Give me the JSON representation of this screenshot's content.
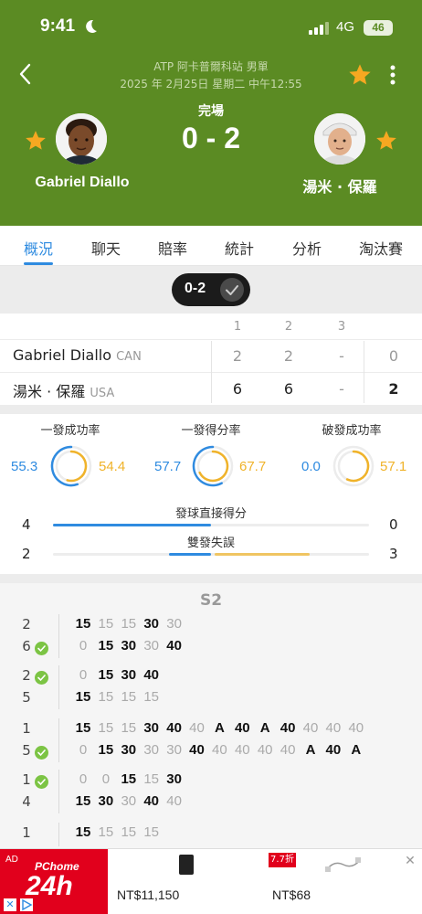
{
  "status_bar": {
    "time": "9:41",
    "network": "4G",
    "battery": "46"
  },
  "header": {
    "event_title": "ATP 阿卡普爾科站 男單",
    "event_date": "2025 年 2月25日 星期二 中午12:55",
    "match_status": "完場",
    "score": "0 - 2",
    "player_left": "Gabriel Diallo",
    "player_right": "湯米 · 保羅"
  },
  "tabs": [
    "概況",
    "聊天",
    "賠率",
    "統計",
    "分析",
    "淘汰賽"
  ],
  "set_pill": {
    "label": "0-2"
  },
  "score_table": {
    "set_headers": [
      "1",
      "2",
      "3"
    ],
    "rows": [
      {
        "name": "Gabriel Diallo",
        "nat": "CAN",
        "sets": [
          "2",
          "2",
          "-"
        ],
        "total": "0"
      },
      {
        "name": "湯米 · 保羅",
        "nat": "USA",
        "sets": [
          "6",
          "6",
          "-"
        ],
        "total": "2"
      }
    ]
  },
  "stats": {
    "rings": [
      {
        "title": "一發成功率",
        "left": "55.3",
        "right": "54.4",
        "left_pct": 55.3,
        "right_pct": 54.4
      },
      {
        "title": "一發得分率",
        "left": "57.7",
        "right": "67.7",
        "left_pct": 57.7,
        "right_pct": 67.7
      },
      {
        "title": "破發成功率",
        "left": "0.0",
        "right": "57.1",
        "left_pct": 0.0,
        "right_pct": 57.1
      }
    ],
    "bars": [
      {
        "title": "發球直接得分",
        "left": "4",
        "right": "0",
        "left_val": 4,
        "right_val": 0
      },
      {
        "title": "雙發失誤",
        "left": "2",
        "right": "3",
        "left_val": 2,
        "right_val": 3
      }
    ]
  },
  "pbp": {
    "set_label": "S2",
    "games": [
      {
        "top": "2",
        "top_serve": false,
        "bottom": "6",
        "bottom_serve": true,
        "top_points": [
          "15",
          "15",
          "15",
          "30",
          "30"
        ],
        "bottom_points": [
          "0",
          "15",
          "30",
          "30",
          "40"
        ]
      },
      {
        "top": "2",
        "top_serve": true,
        "bottom": "5",
        "bottom_serve": false,
        "top_points": [
          "0",
          "15",
          "30",
          "40"
        ],
        "bottom_points": [
          "15",
          "15",
          "15",
          "15"
        ]
      },
      {
        "top": "1",
        "top_serve": false,
        "bottom": "5",
        "bottom_serve": true,
        "top_points": [
          "15",
          "15",
          "15",
          "30",
          "40",
          "40",
          "A",
          "40",
          "A",
          "40",
          "40",
          "40",
          "40"
        ],
        "bottom_points": [
          "0",
          "15",
          "30",
          "30",
          "30",
          "40",
          "40",
          "40",
          "40",
          "40",
          "A",
          "40",
          "A"
        ]
      },
      {
        "top": "1",
        "top_serve": true,
        "bottom": "4",
        "bottom_serve": false,
        "top_points": [
          "0",
          "0",
          "15",
          "15",
          "30"
        ],
        "bottom_points": [
          "15",
          "30",
          "30",
          "40",
          "40"
        ]
      },
      {
        "top": "1",
        "top_serve": false,
        "bottom": "",
        "bottom_serve": false,
        "top_points": [
          "15",
          "15",
          "15",
          "15"
        ],
        "bottom_points": []
      }
    ]
  },
  "ad": {
    "tag": "AD",
    "brand": "PChome",
    "brand_big": "24h",
    "price1": "NT$11,150",
    "discount": "7.7折",
    "price2": "NT$68"
  },
  "colors": {
    "header_bg": "#5b8b23",
    "accent_blue": "#2f8be0",
    "accent_yellow": "#f0b32a",
    "star": "#f6a821"
  }
}
